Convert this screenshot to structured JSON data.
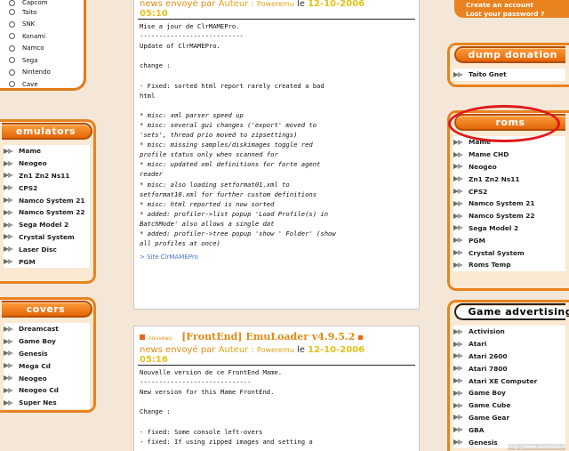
{
  "radio_list": {
    "items": [
      "Capcom",
      "Taito",
      "SNK",
      "Konami",
      "Namco",
      "Sega",
      "Nintendo",
      "Cave"
    ]
  },
  "emulators": {
    "title": "emulators",
    "items": [
      "Mame",
      "Neogeo",
      "Zn1 Zn2 Ns11",
      "CPS2",
      "Namco System 21",
      "Namco System 22",
      "Sega Model 2",
      "Crystal System",
      "Laser Disc",
      "PGM"
    ]
  },
  "covers": {
    "title": "covers",
    "items": [
      "Dreamcast",
      "Game Boy",
      "Genesis",
      "Mega Cd",
      "Neogeo",
      "Neogeo Cd",
      "Super Nes"
    ]
  },
  "account": {
    "create": "Create an account",
    "lost": "Lost your password ?"
  },
  "dump_donation": {
    "title": "dump donation",
    "items": [
      "Taito Gnet"
    ]
  },
  "roms": {
    "title": "roms",
    "items": [
      "Mame",
      "Mame CHD",
      "Neogeo",
      "Zn1 Zn2 Ns11",
      "CPS2",
      "Namco System 21",
      "Namco System 22",
      "Sega Model 2",
      "PGM",
      "Crystal System",
      "Roms Temp"
    ]
  },
  "game_advertising": {
    "title": "Game advertising",
    "items": [
      "Activision",
      "Atari",
      "Atari 2600",
      "Atari 7800",
      "Atari XE Computer",
      "Game Boy",
      "Game Cube",
      "Game Gear",
      "GBA",
      "Genesis"
    ]
  },
  "news1": {
    "meta_prefix": "news envoyé par",
    "author_label": "Auteur :",
    "author": "Poweremu",
    "le": "le",
    "date": "12-10-2006",
    "time": "05:10",
    "lines": [
      "Mise a jour de ClrMAMEPro.",
      "---------------------------",
      "Update of ClrMAMEPro.",
      "",
      "change :",
      "",
      "- Fixed: sorted html report rarely created a bad",
      "html",
      "",
      "* misc: xml parser speed up",
      "* misc: several gui changes ('export' moved to",
      "'sets', thread prio moved to zipsettings)",
      "* misc: missing samples/diskimages toggle red",
      "profile status only when scanned for",
      "* misc: updated xml definitions for forte agent",
      "reader",
      "* misc: also loading setformat01.xml to",
      "setformat10.xml for further custom definitions",
      "* misc: html reported is now sorted",
      "* added: profiler->list popup 'Load Profile(s) in",
      "BatchMode' also allows a single dat",
      "* added: profiler->tree popup 'show ' Folder' (show",
      "all profiles at once)"
    ],
    "link": "> Site ClrMAMEPro"
  },
  "news2": {
    "badge": "nouveau",
    "title": "[FrontEnd] EmuLoader v4.9.5.2",
    "meta_prefix": "news envoyé par",
    "author_label": "Auteur :",
    "author": "Poweremu",
    "le": "le",
    "date": "12-10-2006",
    "time": "05:16",
    "lines": [
      "Nouvelle version de ce FrontEnd Mame.",
      "-----------------------------",
      "New version for this Mame FrontEnd.",
      "",
      "Change :",
      "",
      "- fixed: Some console left-overs",
      "- fixed: If using zipped images and setting a"
    ]
  },
  "watermark": "http://www.alarroba.it"
}
